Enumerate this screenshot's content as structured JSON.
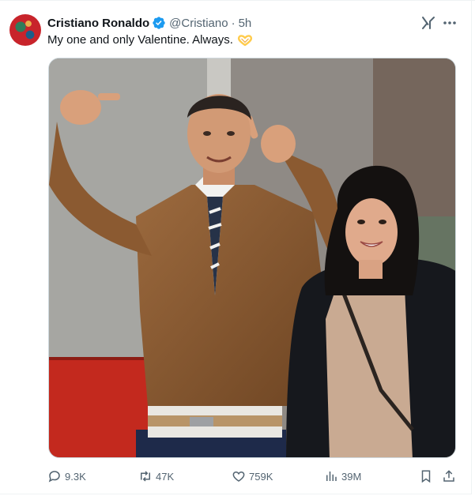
{
  "tweet": {
    "author_name": "Cristiano Ronaldo",
    "handle": "@Cristiano",
    "separator": "·",
    "time": "5h",
    "text": "My one and only Valentine. Always.",
    "emoji_icon": "heart-hands-icon"
  },
  "image": {
    "description_icon": "photo-couple"
  },
  "actions": {
    "replies": "9.3K",
    "reposts": "47K",
    "likes": "759K",
    "views": "39M"
  },
  "colors": {
    "verified_blue": "#1d9bf0",
    "muted_text": "#536471",
    "emoji_yellow": "#ffcc4d"
  }
}
